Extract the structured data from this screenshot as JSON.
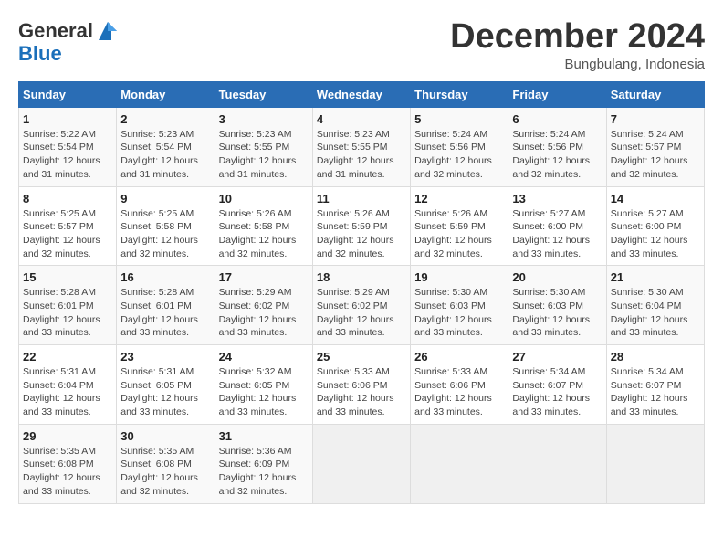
{
  "header": {
    "logo_general": "General",
    "logo_blue": "Blue",
    "month_title": "December 2024",
    "location": "Bungbulang, Indonesia"
  },
  "weekdays": [
    "Sunday",
    "Monday",
    "Tuesday",
    "Wednesday",
    "Thursday",
    "Friday",
    "Saturday"
  ],
  "weeks": [
    [
      {
        "day": "1",
        "sunrise": "5:22 AM",
        "sunset": "5:54 PM",
        "daylight": "12 hours and 31 minutes."
      },
      {
        "day": "2",
        "sunrise": "5:23 AM",
        "sunset": "5:54 PM",
        "daylight": "12 hours and 31 minutes."
      },
      {
        "day": "3",
        "sunrise": "5:23 AM",
        "sunset": "5:55 PM",
        "daylight": "12 hours and 31 minutes."
      },
      {
        "day": "4",
        "sunrise": "5:23 AM",
        "sunset": "5:55 PM",
        "daylight": "12 hours and 31 minutes."
      },
      {
        "day": "5",
        "sunrise": "5:24 AM",
        "sunset": "5:56 PM",
        "daylight": "12 hours and 32 minutes."
      },
      {
        "day": "6",
        "sunrise": "5:24 AM",
        "sunset": "5:56 PM",
        "daylight": "12 hours and 32 minutes."
      },
      {
        "day": "7",
        "sunrise": "5:24 AM",
        "sunset": "5:57 PM",
        "daylight": "12 hours and 32 minutes."
      }
    ],
    [
      {
        "day": "8",
        "sunrise": "5:25 AM",
        "sunset": "5:57 PM",
        "daylight": "12 hours and 32 minutes."
      },
      {
        "day": "9",
        "sunrise": "5:25 AM",
        "sunset": "5:58 PM",
        "daylight": "12 hours and 32 minutes."
      },
      {
        "day": "10",
        "sunrise": "5:26 AM",
        "sunset": "5:58 PM",
        "daylight": "12 hours and 32 minutes."
      },
      {
        "day": "11",
        "sunrise": "5:26 AM",
        "sunset": "5:59 PM",
        "daylight": "12 hours and 32 minutes."
      },
      {
        "day": "12",
        "sunrise": "5:26 AM",
        "sunset": "5:59 PM",
        "daylight": "12 hours and 32 minutes."
      },
      {
        "day": "13",
        "sunrise": "5:27 AM",
        "sunset": "6:00 PM",
        "daylight": "12 hours and 33 minutes."
      },
      {
        "day": "14",
        "sunrise": "5:27 AM",
        "sunset": "6:00 PM",
        "daylight": "12 hours and 33 minutes."
      }
    ],
    [
      {
        "day": "15",
        "sunrise": "5:28 AM",
        "sunset": "6:01 PM",
        "daylight": "12 hours and 33 minutes."
      },
      {
        "day": "16",
        "sunrise": "5:28 AM",
        "sunset": "6:01 PM",
        "daylight": "12 hours and 33 minutes."
      },
      {
        "day": "17",
        "sunrise": "5:29 AM",
        "sunset": "6:02 PM",
        "daylight": "12 hours and 33 minutes."
      },
      {
        "day": "18",
        "sunrise": "5:29 AM",
        "sunset": "6:02 PM",
        "daylight": "12 hours and 33 minutes."
      },
      {
        "day": "19",
        "sunrise": "5:30 AM",
        "sunset": "6:03 PM",
        "daylight": "12 hours and 33 minutes."
      },
      {
        "day": "20",
        "sunrise": "5:30 AM",
        "sunset": "6:03 PM",
        "daylight": "12 hours and 33 minutes."
      },
      {
        "day": "21",
        "sunrise": "5:30 AM",
        "sunset": "6:04 PM",
        "daylight": "12 hours and 33 minutes."
      }
    ],
    [
      {
        "day": "22",
        "sunrise": "5:31 AM",
        "sunset": "6:04 PM",
        "daylight": "12 hours and 33 minutes."
      },
      {
        "day": "23",
        "sunrise": "5:31 AM",
        "sunset": "6:05 PM",
        "daylight": "12 hours and 33 minutes."
      },
      {
        "day": "24",
        "sunrise": "5:32 AM",
        "sunset": "6:05 PM",
        "daylight": "12 hours and 33 minutes."
      },
      {
        "day": "25",
        "sunrise": "5:33 AM",
        "sunset": "6:06 PM",
        "daylight": "12 hours and 33 minutes."
      },
      {
        "day": "26",
        "sunrise": "5:33 AM",
        "sunset": "6:06 PM",
        "daylight": "12 hours and 33 minutes."
      },
      {
        "day": "27",
        "sunrise": "5:34 AM",
        "sunset": "6:07 PM",
        "daylight": "12 hours and 33 minutes."
      },
      {
        "day": "28",
        "sunrise": "5:34 AM",
        "sunset": "6:07 PM",
        "daylight": "12 hours and 33 minutes."
      }
    ],
    [
      {
        "day": "29",
        "sunrise": "5:35 AM",
        "sunset": "6:08 PM",
        "daylight": "12 hours and 33 minutes."
      },
      {
        "day": "30",
        "sunrise": "5:35 AM",
        "sunset": "6:08 PM",
        "daylight": "12 hours and 32 minutes."
      },
      {
        "day": "31",
        "sunrise": "5:36 AM",
        "sunset": "6:09 PM",
        "daylight": "12 hours and 32 minutes."
      },
      null,
      null,
      null,
      null
    ]
  ]
}
